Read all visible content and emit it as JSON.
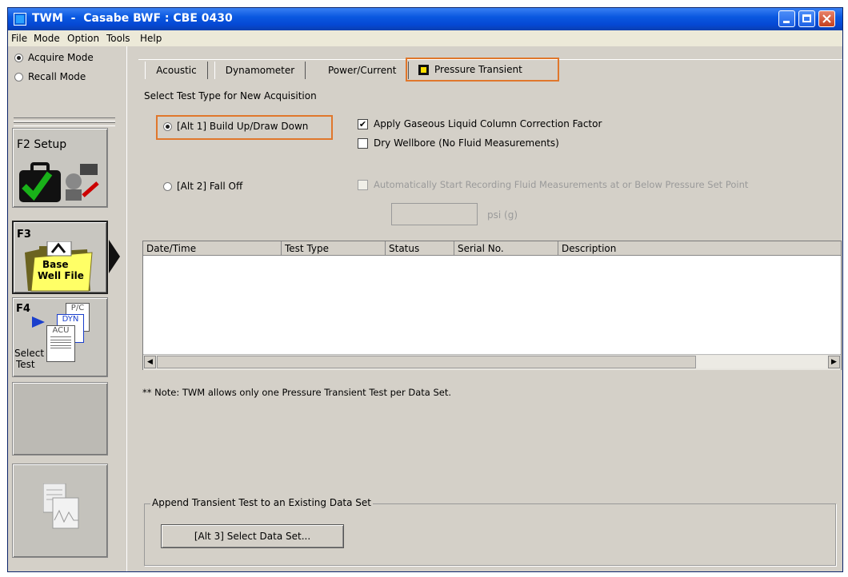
{
  "window": {
    "title": "TWM  -  Casabe BWF : CBE 0430",
    "min_label": "–",
    "max_label": "□",
    "close_label": "✕"
  },
  "menu": [
    "File",
    "Mode",
    "Option",
    "Tools",
    "Help"
  ],
  "mode": {
    "acquire": "Acquire Mode",
    "recall": "Recall Mode"
  },
  "fkeys": {
    "setup": "F2 Setup",
    "f3": "F3",
    "base_well_file_1": "Base",
    "base_well_file_2": "Well File",
    "f4": "F4",
    "select_1": "Select",
    "select_2": "Test",
    "pc": "P/C",
    "dyn": "DYN",
    "acu": "ACU"
  },
  "tabs": [
    "Acoustic",
    "Dynamometer",
    "Power/Current",
    "Pressure Transient"
  ],
  "form": {
    "section_label": "Select Test Type for New Acquisition",
    "opt1": "[Alt 1]  Build Up/Draw Down",
    "opt2": "[Alt 2]  Fall Off",
    "chk1": "Apply Gaseous Liquid Column Correction Factor",
    "chk2": "Dry Wellbore (No Fluid Measurements)",
    "chk3": "Automatically Start Recording Fluid Measurements at or Below Pressure Set Point",
    "psi_value": "",
    "psi_unit": "psi (g)"
  },
  "table": {
    "columns": [
      "Date/Time",
      "Test Type",
      "Status",
      "Serial No.",
      "Description"
    ],
    "rows": []
  },
  "note": "** Note:  TWM allows only one Pressure Transient Test per Data Set.",
  "append": {
    "group_label": "Append Transient Test to an Existing Data Set",
    "button": "[Alt 3]  Select Data Set..."
  },
  "colors": {
    "highlight": "#e0772c",
    "titlebar": "#0548d4",
    "folder_yellow": "#ffff66"
  }
}
